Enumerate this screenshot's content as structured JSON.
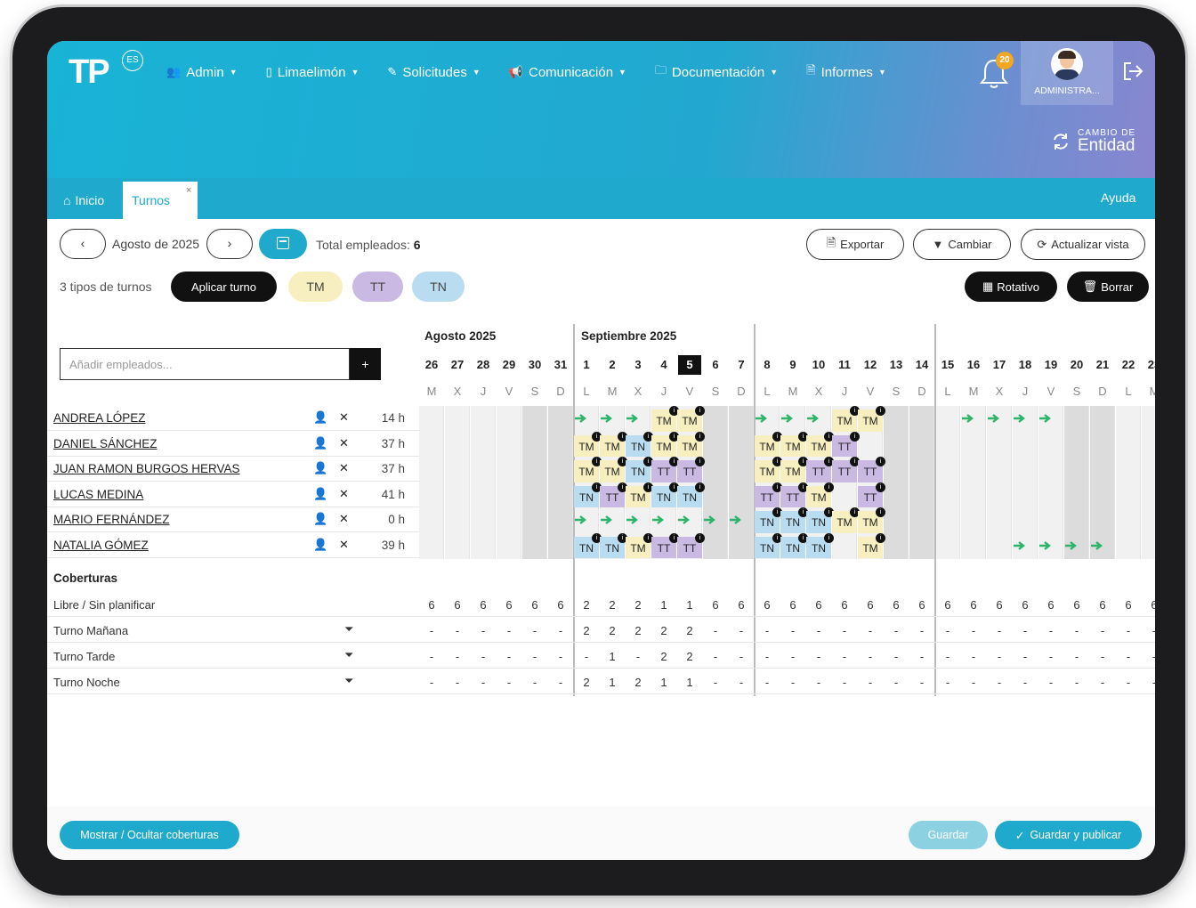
{
  "header": {
    "logo": "TP",
    "logo_badge": "ES",
    "nav": [
      {
        "label": "Admin",
        "icon": "users-icon"
      },
      {
        "label": "Limaelimón",
        "icon": "building-icon"
      },
      {
        "label": "Solicitudes",
        "icon": "edit-icon"
      },
      {
        "label": "Comunicación",
        "icon": "megaphone-icon"
      },
      {
        "label": "Documentación",
        "icon": "folder-icon"
      },
      {
        "label": "Informes",
        "icon": "report-icon"
      }
    ],
    "notifications": "20",
    "user_name": "ADMINISTRA...",
    "entity_small": "CAMBIO DE",
    "entity_big": "Entidad"
  },
  "tabs": {
    "home": "Inicio",
    "active": "Turnos",
    "close": "×",
    "help": "Ayuda"
  },
  "toolbar": {
    "month": "Agosto de 2025",
    "total_label": "Total empleados:",
    "total_value": "6",
    "export": "Exportar",
    "change": "Cambiar",
    "refresh": "Actualizar vista",
    "types_label": "3 tipos de turnos",
    "apply": "Aplicar turno",
    "shift_tm": "TM",
    "shift_tt": "TT",
    "shift_tn": "TN",
    "rotativo": "Rotativo",
    "borrar": "Borrar"
  },
  "search": {
    "placeholder": "Añadir empleados..."
  },
  "calendar": {
    "month1": "Agosto 2025",
    "month2": "Septiembre 2025",
    "days": [
      "26",
      "27",
      "28",
      "29",
      "30",
      "31",
      "1",
      "2",
      "3",
      "4",
      "5",
      "6",
      "7",
      "8",
      "9",
      "10",
      "11",
      "12",
      "13",
      "14",
      "15",
      "16",
      "17",
      "18",
      "19",
      "20",
      "21",
      "22",
      "23"
    ],
    "letters": [
      "M",
      "X",
      "J",
      "V",
      "S",
      "D",
      "L",
      "M",
      "X",
      "J",
      "V",
      "S",
      "D",
      "L",
      "M",
      "X",
      "J",
      "V",
      "S",
      "D",
      "L",
      "M",
      "X",
      "J",
      "V",
      "S",
      "D",
      "L",
      "M"
    ],
    "today_index": 10
  },
  "employees": [
    {
      "name": "ANDREA LÓPEZ",
      "hours": "14 h"
    },
    {
      "name": "DANIEL SÁNCHEZ",
      "hours": "37 h"
    },
    {
      "name": "JUAN RAMON BURGOS HERVAS",
      "hours": "37 h"
    },
    {
      "name": "LUCAS MEDINA",
      "hours": "41 h"
    },
    {
      "name": "MARIO FERNÁNDEZ",
      "hours": "0 h"
    },
    {
      "name": "NATALIA GÓMEZ",
      "hours": "39 h"
    }
  ],
  "schedule": [
    {
      "shifts": {
        "9": "TM",
        "10": "TM",
        "16": "TM",
        "17": "TM"
      },
      "arrows": [
        6,
        7,
        8,
        13,
        14,
        15,
        21,
        22,
        23,
        24
      ]
    },
    {
      "shifts": {
        "6": "TM",
        "7": "TM",
        "8": "TN",
        "9": "TM",
        "10": "TM",
        "13": "TM",
        "14": "TM",
        "15": "TM",
        "16": "TT"
      },
      "arrows": []
    },
    {
      "shifts": {
        "6": "TM",
        "7": "TM",
        "8": "TN",
        "9": "TT",
        "10": "TT",
        "13": "TM",
        "14": "TM",
        "15": "TT",
        "16": "TT",
        "17": "TT"
      },
      "arrows": []
    },
    {
      "shifts": {
        "6": "TN",
        "7": "TT",
        "8": "TM",
        "9": "TN",
        "10": "TN",
        "13": "TT",
        "14": "TT",
        "15": "TM",
        "17": "TT"
      },
      "arrows": []
    },
    {
      "shifts": {
        "13": "TN",
        "14": "TN",
        "15": "TN",
        "16": "TM",
        "17": "TM"
      },
      "arrows": [
        6,
        7,
        8,
        9,
        10,
        11,
        12
      ]
    },
    {
      "shifts": {
        "6": "TN",
        "7": "TN",
        "8": "TM",
        "9": "TT",
        "10": "TT",
        "13": "TN",
        "14": "TN",
        "15": "TN",
        "17": "TM"
      },
      "arrows": [
        23,
        24,
        25,
        26
      ]
    }
  ],
  "coverage": {
    "title": "Coberturas",
    "rows": [
      {
        "label": "Libre / Sin planificar",
        "filter": false,
        "values": [
          "6",
          "6",
          "6",
          "6",
          "6",
          "6",
          "2",
          "2",
          "2",
          "1",
          "1",
          "6",
          "6",
          "6",
          "6",
          "6",
          "6",
          "6",
          "6",
          "6",
          "6",
          "6",
          "6",
          "6",
          "6",
          "6",
          "6",
          "6",
          "6"
        ]
      },
      {
        "label": "Turno Mañana",
        "filter": true,
        "values": [
          "-",
          "-",
          "-",
          "-",
          "-",
          "-",
          "2",
          "2",
          "2",
          "2",
          "2",
          "-",
          "-",
          "-",
          "-",
          "-",
          "-",
          "-",
          "-",
          "-",
          "-",
          "-",
          "-",
          "-",
          "-",
          "-",
          "-",
          "-",
          "-"
        ]
      },
      {
        "label": "Turno Tarde",
        "filter": true,
        "values": [
          "-",
          "-",
          "-",
          "-",
          "-",
          "-",
          "-",
          "1",
          "-",
          "2",
          "2",
          "-",
          "-",
          "-",
          "-",
          "-",
          "-",
          "-",
          "-",
          "-",
          "-",
          "-",
          "-",
          "-",
          "-",
          "-",
          "-",
          "-",
          "-"
        ]
      },
      {
        "label": "Turno Noche",
        "filter": true,
        "values": [
          "-",
          "-",
          "-",
          "-",
          "-",
          "-",
          "2",
          "1",
          "2",
          "1",
          "1",
          "-",
          "-",
          "-",
          "-",
          "-",
          "-",
          "-",
          "-",
          "-",
          "-",
          "-",
          "-",
          "-",
          "-",
          "-",
          "-",
          "-",
          "-"
        ]
      }
    ]
  },
  "footer": {
    "toggle": "Mostrar / Ocultar coberturas",
    "save": "Guardar",
    "save_publish": "Guardar y publicar"
  },
  "colors": {
    "accent": "#1fa9cc",
    "tm": "#f7efbf",
    "tt": "#c9b9e3",
    "tn": "#b9dcf0",
    "weekend": "#dcdcdc",
    "arrow": "#2db36a"
  }
}
